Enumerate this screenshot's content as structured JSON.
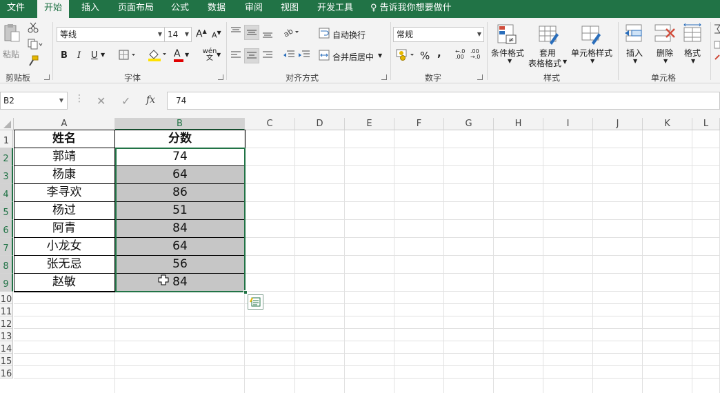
{
  "menu": {
    "tabs": [
      "文件",
      "开始",
      "插入",
      "页面布局",
      "公式",
      "数据",
      "审阅",
      "视图",
      "开发工具"
    ],
    "active": "开始",
    "tell_me": "告诉我你想要做什么"
  },
  "ribbon": {
    "clipboard": {
      "paste": "粘贴",
      "group": "剪贴板"
    },
    "font": {
      "family": "等线",
      "size": "14",
      "group": "字体",
      "bold": "B",
      "italic": "I",
      "underline": "U",
      "font_color_glyph": "A",
      "phonetic": "wén 文",
      "grow": "A",
      "shrink": "A",
      "highlight_color": "#FFE100",
      "font_color": "#E00000"
    },
    "alignment": {
      "wrap": "自动换行",
      "merge": "合并后居中",
      "group": "对齐方式"
    },
    "number": {
      "format": "常规",
      "percent": "%",
      "comma": ",",
      "inc_dec": "←.0 .00",
      "dec_dec": ".00 →.0",
      "group": "数字"
    },
    "styles": {
      "conditional": "条件格式",
      "table_1": "套用",
      "table_2": "表格格式",
      "cell_styles": "单元格样式",
      "group": "样式"
    },
    "cells": {
      "insert": "插入",
      "delete": "删除",
      "format": "格式",
      "group": "单元格"
    }
  },
  "formula_bar": {
    "name_box": "B2",
    "value": "74",
    "fx": "fx"
  },
  "grid": {
    "columns": [
      "A",
      "B",
      "C",
      "D",
      "E",
      "F",
      "G",
      "H",
      "I",
      "J",
      "K",
      "L"
    ],
    "rows": [
      "1",
      "2",
      "3",
      "4",
      "5",
      "6",
      "7",
      "8",
      "9",
      "10",
      "11",
      "12",
      "13",
      "14",
      "15",
      "16"
    ],
    "header": {
      "name": "姓名",
      "score": "分数"
    },
    "data": [
      {
        "name": "郭靖",
        "score": "74"
      },
      {
        "name": "杨康",
        "score": "64"
      },
      {
        "name": "李寻欢",
        "score": "86"
      },
      {
        "name": "杨过",
        "score": "51"
      },
      {
        "name": "阿青",
        "score": "84"
      },
      {
        "name": "小龙女",
        "score": "64"
      },
      {
        "name": "张无忌",
        "score": "56"
      },
      {
        "name": "赵敏",
        "score": "84"
      }
    ]
  },
  "colors": {
    "excel_green": "#217346",
    "selection_fill": "#C6C6C6"
  }
}
